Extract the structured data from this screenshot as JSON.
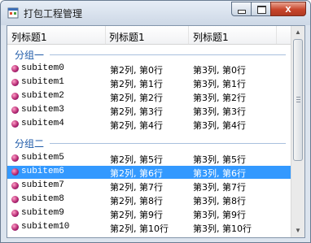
{
  "window": {
    "title": "打包工程管理",
    "close_glyph": "x"
  },
  "columns": [
    "列标题1",
    "列标题1",
    "列标题1"
  ],
  "groups": [
    {
      "label": "分组一",
      "rows": [
        {
          "c1": "subitem0",
          "c2": "第2列, 第0行",
          "c3": "第3列, 第0行"
        },
        {
          "c1": "subitem1",
          "c2": "第2列, 第1行",
          "c3": "第3列, 第1行"
        },
        {
          "c1": "subitem2",
          "c2": "第2列, 第2行",
          "c3": "第3列, 第2行"
        },
        {
          "c1": "subitem3",
          "c2": "第2列, 第3行",
          "c3": "第3列, 第3行"
        },
        {
          "c1": "subitem4",
          "c2": "第2列, 第4行",
          "c3": "第3列, 第4行"
        }
      ]
    },
    {
      "label": "分组二",
      "rows": [
        {
          "c1": "subitem5",
          "c2": "第2列, 第5行",
          "c3": "第3列, 第5行"
        },
        {
          "c1": "subitem6",
          "c2": "第2列, 第6行",
          "c3": "第3列, 第6行",
          "selected": true
        },
        {
          "c1": "subitem7",
          "c2": "第2列, 第7行",
          "c3": "第3列, 第7行"
        },
        {
          "c1": "subitem8",
          "c2": "第2列, 第8行",
          "c3": "第3列, 第8行"
        },
        {
          "c1": "subitem9",
          "c2": "第2列, 第9行",
          "c3": "第3列, 第9行"
        },
        {
          "c1": "subitem10",
          "c2": "第2列, 第10行",
          "c3": "第3列, 第10行"
        }
      ]
    }
  ],
  "colors": {
    "selection": "#3399ff",
    "group_label": "#1e5aa8"
  },
  "icons": {
    "app": "window-app-icon",
    "row": "magenta-orb-icon"
  }
}
